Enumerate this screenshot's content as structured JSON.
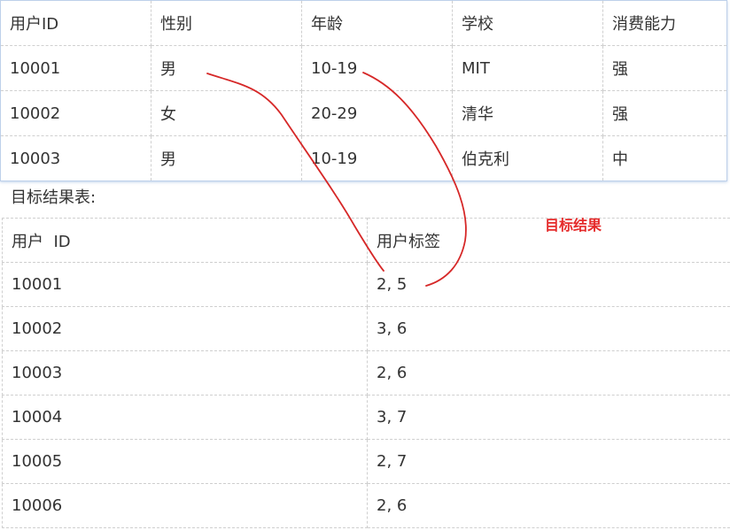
{
  "source_table": {
    "headers": [
      "用户ID",
      "性别",
      "年龄",
      "学校",
      "消费能力"
    ],
    "rows": [
      [
        "10001",
        "男",
        "10-19",
        "MIT",
        "强"
      ],
      [
        "10002",
        "女",
        "20-29",
        "清华",
        "强"
      ],
      [
        "10003",
        "男",
        "10-19",
        "伯克利",
        "中"
      ]
    ]
  },
  "subtitle": "目标结果表:",
  "annotation": "目标结果",
  "result_table": {
    "headers": [
      "用户  ID",
      "用户标签"
    ],
    "rows": [
      [
        "10001",
        "2, 5"
      ],
      [
        "10002",
        "3, 6"
      ],
      [
        "10003",
        "2, 6"
      ],
      [
        "10004",
        "3, 7"
      ],
      [
        "10005",
        "2, 7"
      ],
      [
        "10006",
        "2, 6"
      ]
    ]
  },
  "colors": {
    "annotation": "#e52b2b",
    "arrow": "#d62828",
    "table_border": "#cfcfcf",
    "table_frame": "#bdd0ea"
  }
}
